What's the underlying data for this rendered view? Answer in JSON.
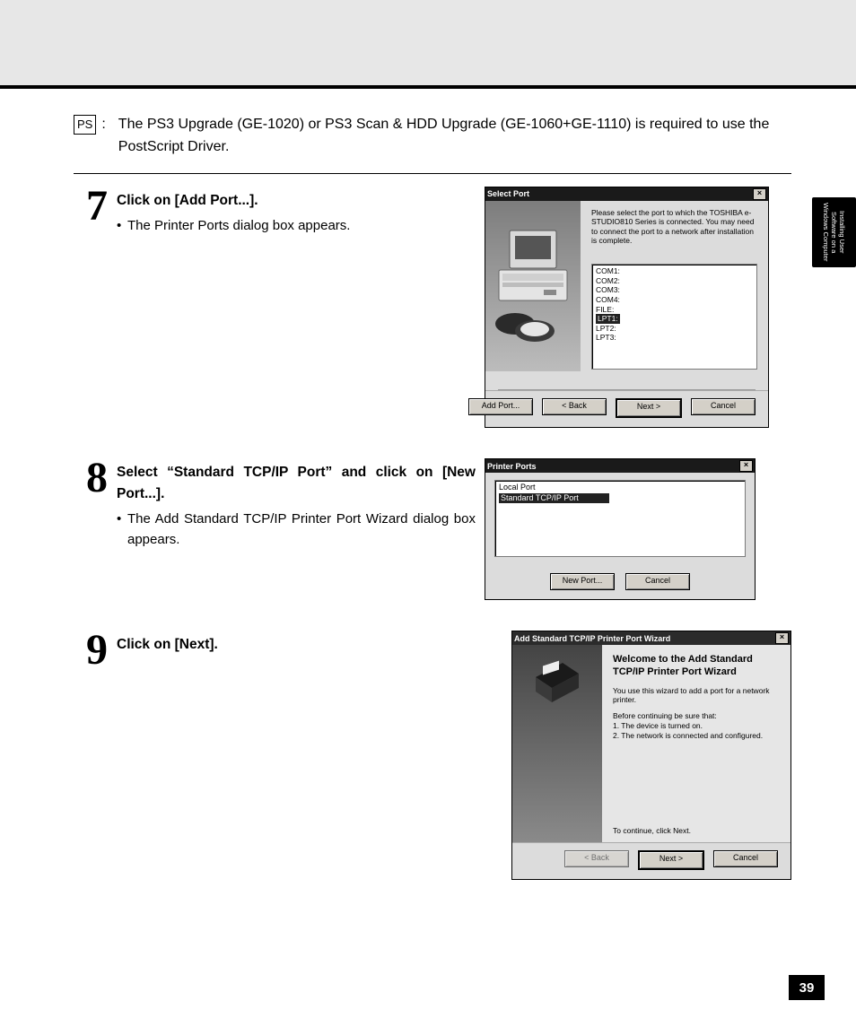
{
  "side_tab": "Installing User\nSoftware on a\nWindows Computer",
  "page_number": "39",
  "ps_badge": "PS",
  "ps_note": "The PS3 Upgrade (GE-1020) or PS3 Scan & HDD Upgrade (GE-1060+GE-1110) is required to use the PostScript Driver.",
  "steps": {
    "7": {
      "num": "7",
      "title": "Click on [Add Port...].",
      "bullet": "The Printer Ports dialog box appears.",
      "dialog": {
        "title": "Select Port",
        "message": "Please select the port to which the TOSHIBA e-STUDIO810 Series is connected. You may need to connect the port to a network after installation is complete.",
        "ports": [
          "COM1:",
          "COM2:",
          "COM3:",
          "COM4:",
          "FILE:",
          "LPT1:",
          "LPT2:",
          "LPT3:"
        ],
        "selected": "LPT1:",
        "buttons": {
          "add": "Add Port...",
          "back": "< Back",
          "next": "Next >",
          "cancel": "Cancel"
        }
      }
    },
    "8": {
      "num": "8",
      "title": "Select “Standard TCP/IP Port” and click on [New Port...].",
      "bullet": "The Add Standard TCP/IP Printer Port Wizard dialog box appears.",
      "dialog": {
        "title": "Printer Ports",
        "items": [
          "Local Port",
          "Standard TCP/IP Port"
        ],
        "selected": "Standard TCP/IP Port",
        "buttons": {
          "new": "New Port...",
          "cancel": "Cancel"
        }
      }
    },
    "9": {
      "num": "9",
      "title": "Click on [Next].",
      "dialog": {
        "title": "Add Standard TCP/IP Printer Port Wizard",
        "heading": "Welcome to the Add Standard TCP/IP Printer Port Wizard",
        "sub": "You use this wizard to add a port for a network printer.",
        "before": "Before continuing be sure that:",
        "points": [
          "1.  The device is turned on.",
          "2.  The network is connected and configured."
        ],
        "continue": "To continue, click Next.",
        "buttons": {
          "back": "< Back",
          "next": "Next >",
          "cancel": "Cancel"
        }
      }
    }
  }
}
